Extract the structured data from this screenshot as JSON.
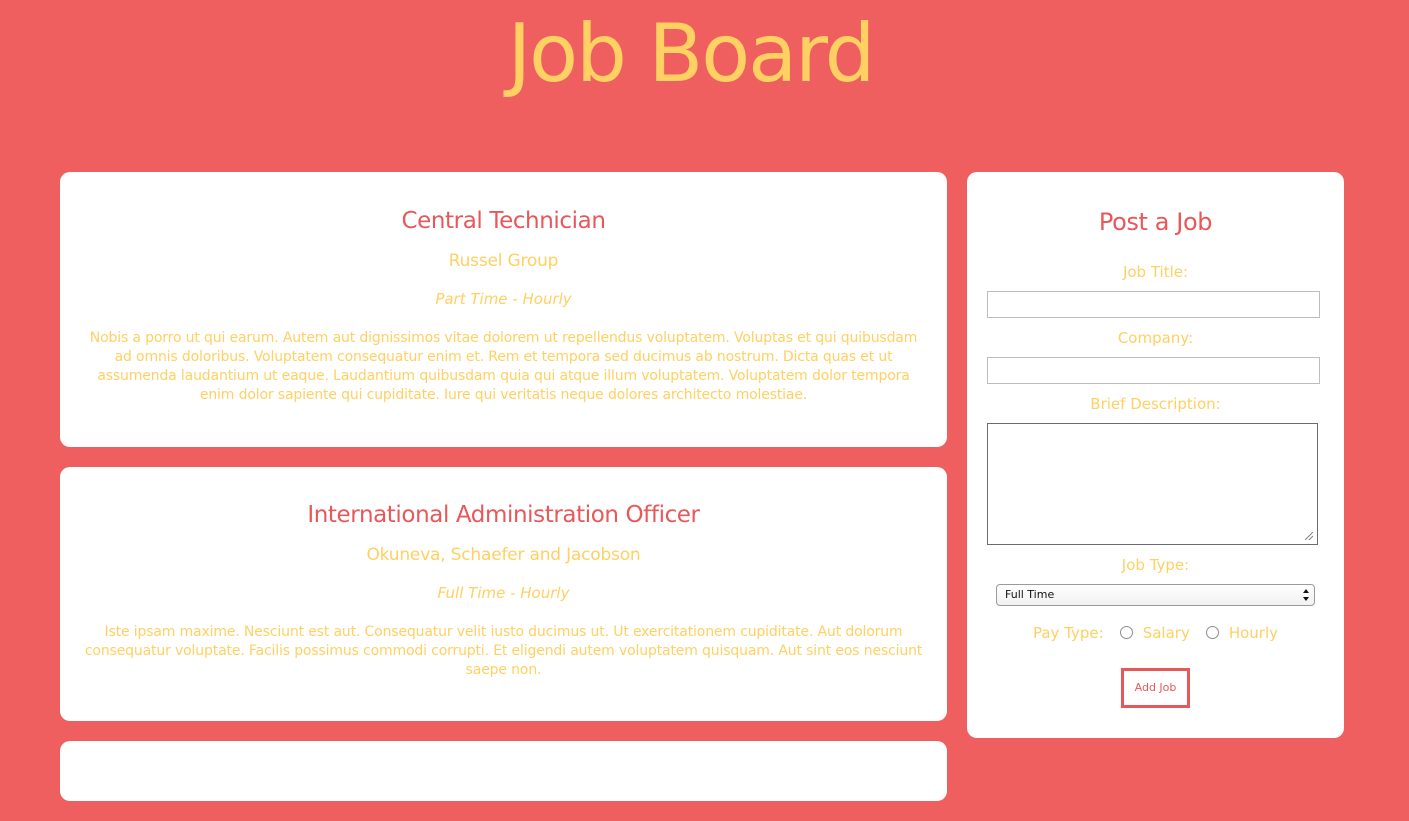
{
  "header": {
    "title": "Job Board"
  },
  "jobs": [
    {
      "title": "Central Technician",
      "company": "Russel Group",
      "type": "Part Time - Hourly",
      "description": "Nobis a porro ut qui earum. Autem aut dignissimos vitae dolorem ut repellendus voluptatem. Voluptas et qui quibusdam ad omnis doloribus. Voluptatem consequatur enim et. Rem et tempora sed ducimus ab nostrum. Dicta quas et ut assumenda laudantium ut eaque. Laudantium quibusdam quia qui atque illum voluptatem. Voluptatem dolor tempora enim dolor sapiente qui cupiditate. Iure qui veritatis neque dolores architecto molestiae."
    },
    {
      "title": "International Administration Officer",
      "company": "Okuneva, Schaefer and Jacobson",
      "type": "Full Time - Hourly",
      "description": "Iste ipsam maxime. Nesciunt est aut. Consequatur velit iusto ducimus ut. Ut exercitationem cupiditate. Aut dolorum consequatur voluptate. Facilis possimus commodi corrupti. Et eligendi autem voluptatem quisquam. Aut sint eos nesciunt saepe non."
    }
  ],
  "post_form": {
    "title": "Post a Job",
    "job_title_label": "Job Title:",
    "job_title_value": "",
    "company_label": "Company:",
    "company_value": "",
    "description_label": "Brief Description:",
    "description_value": "",
    "job_type_label": "Job Type:",
    "job_type_selected": "Full Time",
    "pay_type_label": "Pay Type:",
    "pay_option_salary": "Salary",
    "pay_option_hourly": "Hourly",
    "submit_label": "Add Job"
  },
  "colors": {
    "background": "#f05f5f",
    "accent_red": "#e8585a",
    "accent_yellow": "#ffd062",
    "card": "#ffffff"
  }
}
